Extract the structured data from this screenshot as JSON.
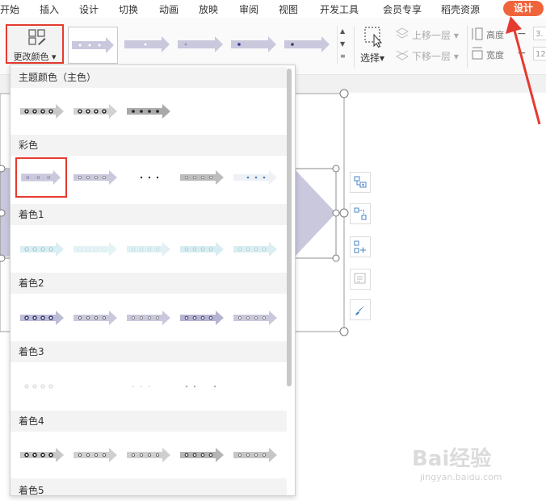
{
  "menu": {
    "items": [
      "开始",
      "插入",
      "设计",
      "切换",
      "动画",
      "放映",
      "审阅",
      "视图",
      "开发工具",
      "会员专享",
      "稻壳资源"
    ],
    "design_tab": "设计"
  },
  "ribbon": {
    "change_color_label": "更改颜色",
    "select_label": "选择",
    "bring_forward": "上移一层",
    "send_backward": "下移一层",
    "height_label": "高度",
    "width_label": "宽度",
    "height_value": "3.",
    "width_value": "12"
  },
  "dropdown": {
    "sections": [
      "主题颜色（主色）",
      "彩色",
      "着色1",
      "着色2",
      "着色3",
      "着色4",
      "着色5"
    ]
  },
  "colors": {
    "accent_red": "#e53a2f",
    "design_orange": "#f0643c",
    "arrow_lavender": "#c9c8dd"
  },
  "watermark": {
    "brand": "Bai经验",
    "url": "jingyan.baidu.com"
  }
}
